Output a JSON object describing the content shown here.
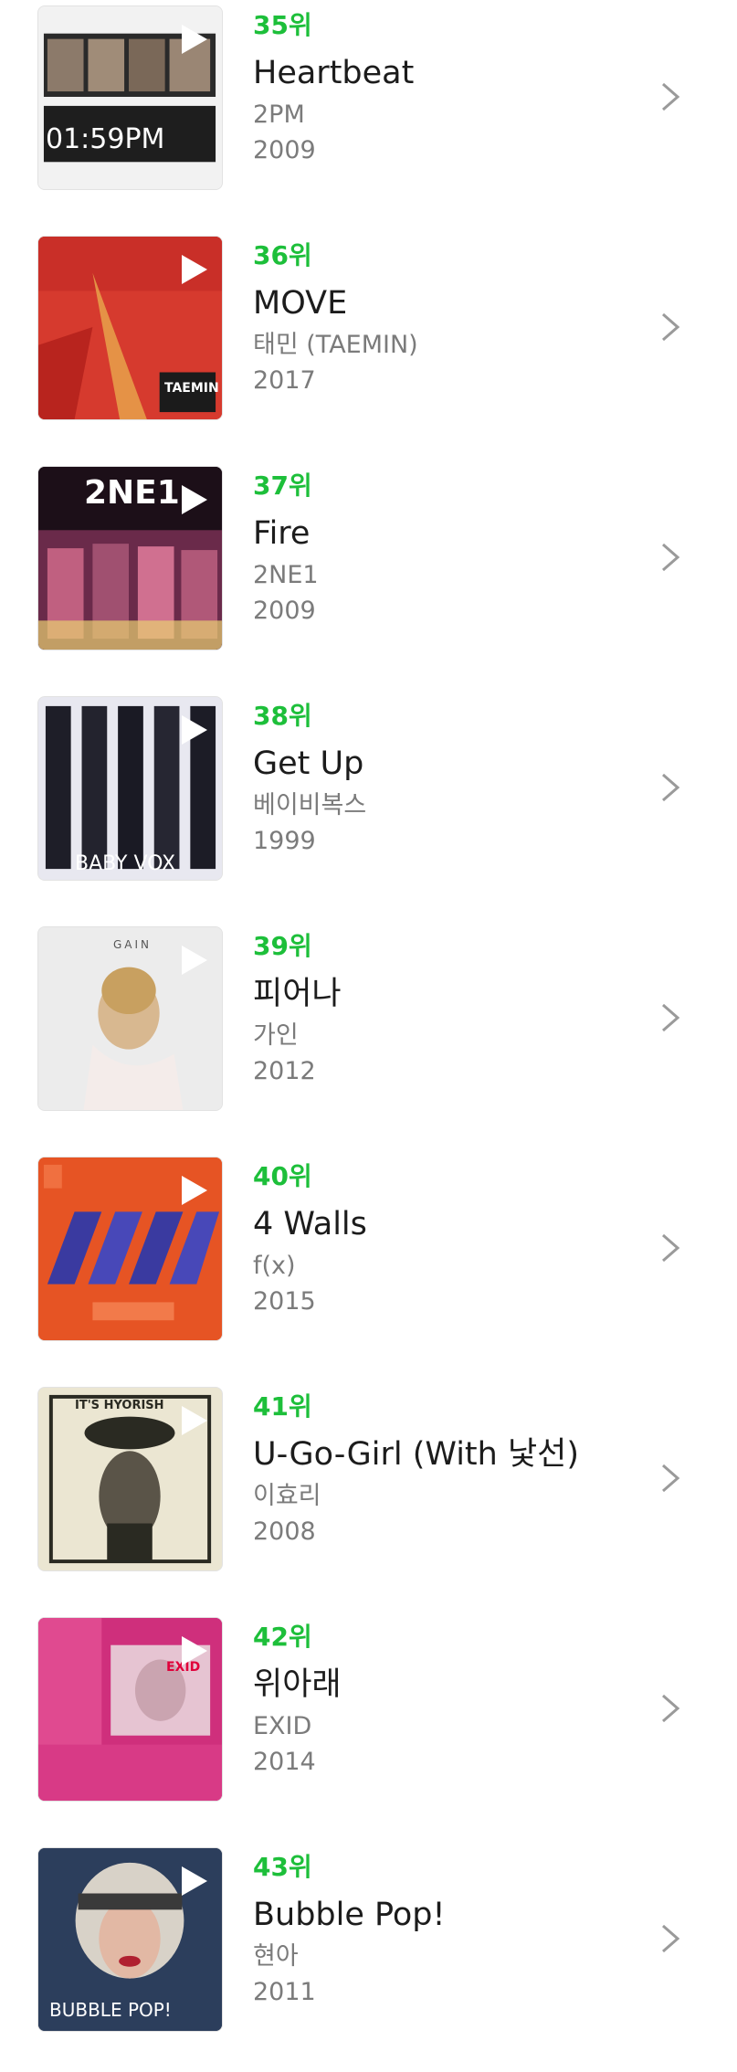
{
  "colors": {
    "rank": "#1dbf3a",
    "title": "#1c1c1c",
    "meta": "#7b7b7b",
    "chevron": "#9a9a9a"
  },
  "songs": [
    {
      "rank": "35위",
      "title": "Heartbeat",
      "artist": "2PM",
      "year": "2009",
      "cover_text": "01:59PM"
    },
    {
      "rank": "36위",
      "title": "MOVE",
      "artist": "태민 (TAEMIN)",
      "year": "2017",
      "cover_text": "TAEMIN"
    },
    {
      "rank": "37위",
      "title": "Fire",
      "artist": "2NE1",
      "year": "2009",
      "cover_text": "2NE1"
    },
    {
      "rank": "38위",
      "title": "Get Up",
      "artist": "베이비복스",
      "year": "1999",
      "cover_text": "BABY VOX"
    },
    {
      "rank": "39위",
      "title": "피어나",
      "artist": "가인",
      "year": "2012",
      "cover_text": "GAIN"
    },
    {
      "rank": "40위",
      "title": "4 Walls",
      "artist": "f(x)",
      "year": "2015",
      "cover_text": ""
    },
    {
      "rank": "41위",
      "title": "U-Go-Girl (With 낯선)",
      "artist": "이효리",
      "year": "2008",
      "cover_text": "IT'S HYORISH"
    },
    {
      "rank": "42위",
      "title": "위아래",
      "artist": "EXID",
      "year": "2014",
      "cover_text": "EXID"
    },
    {
      "rank": "43위",
      "title": "Bubble Pop!",
      "artist": "현아",
      "year": "2011",
      "cover_text": "BUBBLE POP!"
    }
  ],
  "icons": {
    "play": "play-icon",
    "chevron": "chevron-right-icon"
  }
}
